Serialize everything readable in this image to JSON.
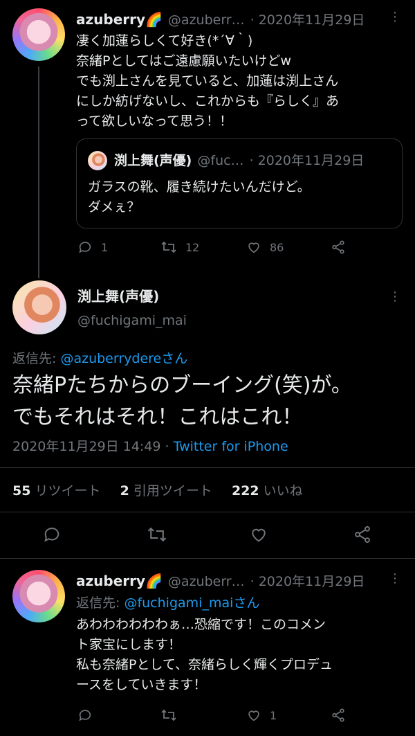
{
  "tweet1": {
    "name": "azuberry🌈",
    "handle": "@azuberr…",
    "date": "· 2020年11月29日",
    "text": "凄く加蓮らしくて好き(*´∀｀)\n奈緒Pとしてはご遠慮願いたいけどw\nでも渕上さんを見ていると、加蓮は渕上さん\nにしか紡げないし、これからも『らしく』あ\nって欲しいなって思う！！",
    "quote": {
      "name": "渕上舞(声優)",
      "handle": "@fuc…",
      "date": "· 2020年11月29日",
      "text": "ガラスの靴、履き続けたいんだけど。\nダメぇ？"
    },
    "replies": "1",
    "retweets": "12",
    "likes": "86"
  },
  "main": {
    "name": "渕上舞(声優)",
    "handle": "@fuchigami_mai",
    "reply_prefix": "返信先: ",
    "reply_to": "@azuberrydereさん",
    "text": "奈緒Pたちからのブーイング(笑)が。\nでもそれはそれ！これはこれ！",
    "timestamp": "2020年11月29日 14:49 · ",
    "source": "Twitter for iPhone",
    "retweet_count": "55",
    "retweet_label": " リツイート",
    "quote_count": "2",
    "quote_label": " 引用ツイート",
    "like_count": "222",
    "like_label": " いいね"
  },
  "tweet3": {
    "name": "azuberry🌈",
    "handle": "@azuberr…",
    "date": "· 2020年11月29日",
    "reply_prefix": "返信先: ",
    "reply_to": "@fuchigami_maiさん",
    "text": "あわわわわわわぁ…恐縮です！このコメン\nト家宝にします！\n私も奈緒Pとして、奈緒らしく輝くプロデュ\nースをしていきます！",
    "replies": "",
    "retweets": "",
    "likes": "1"
  },
  "colors": {
    "background": "#000000",
    "text": "#e7e9ea",
    "muted": "#71767b",
    "link": "#1d9bf0",
    "divider": "#2f3336"
  },
  "icons": [
    "reply-icon",
    "retweet-icon",
    "like-icon",
    "share-icon",
    "more-icon"
  ]
}
